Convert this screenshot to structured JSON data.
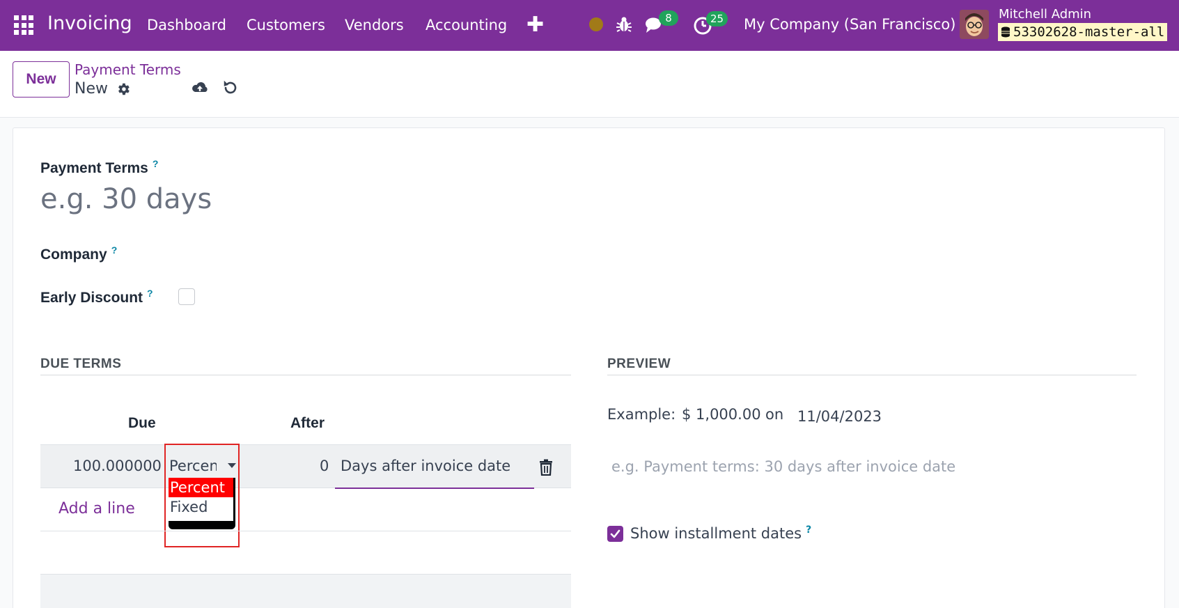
{
  "navbar": {
    "app_name": "Invoicing",
    "menus": [
      "Dashboard",
      "Customers",
      "Vendors",
      "Accounting"
    ],
    "messages_count": "8",
    "activities_count": "25",
    "company": "My Company (San Francisco)",
    "user_name": "Mitchell Admin",
    "database": "53302628-master-all",
    "brand_color": "#7c2f99"
  },
  "control_panel": {
    "new_label": "New",
    "breadcrumb_parent": "Payment Terms",
    "breadcrumb_current": "New"
  },
  "form": {
    "name_label": "Payment Terms",
    "name_help": "?",
    "name_placeholder": "e.g. 30 days",
    "company_label": "Company",
    "company_help": "?",
    "early_discount_label": "Early Discount",
    "early_discount_help": "?",
    "early_discount_checked": false
  },
  "due_terms": {
    "section_title": "DUE TERMS",
    "col_due": "Due",
    "col_after": "After",
    "rows": [
      {
        "value": "100.000000",
        "value_type": "Percen",
        "after": "0",
        "delay_type": "Days after invoice date"
      }
    ],
    "dropdown_options": [
      "Percent",
      "Fixed"
    ],
    "dropdown_selected": "Percent",
    "add_line_label": "Add a line"
  },
  "preview": {
    "section_title": "PREVIEW",
    "example_label": "Example:",
    "amount": "$ 1,000.00",
    "on_label": "on",
    "date": "11/04/2023",
    "note_placeholder": "e.g. Payment terms: 30 days after invoice date",
    "show_installments_label": "Show installment dates",
    "show_installments_help": "?",
    "show_installments_checked": true
  }
}
